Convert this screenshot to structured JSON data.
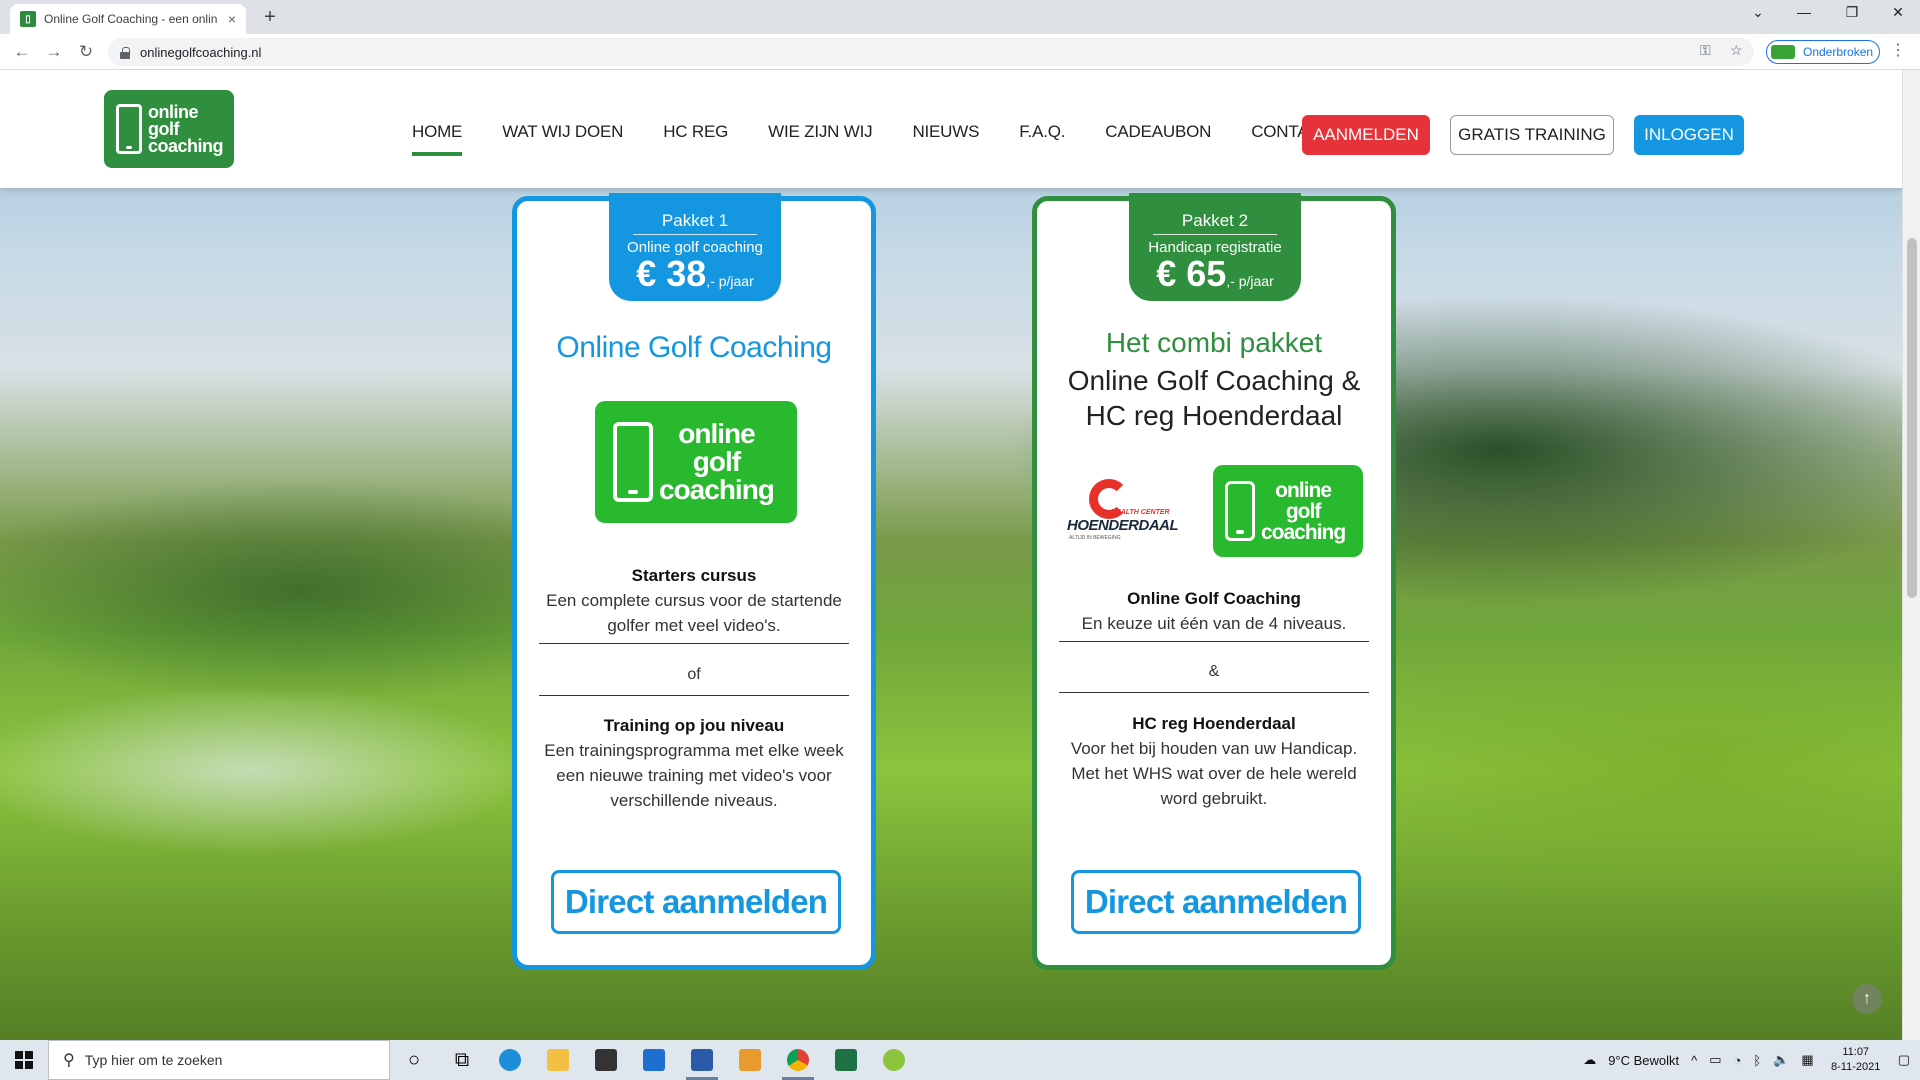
{
  "browser": {
    "tab_title": "Online Golf Coaching - een onlin",
    "tab_close": "×",
    "new_tab": "+",
    "url": "onlinegolfcoaching.nl",
    "profile_label": "Onderbroken",
    "win_minimize": "—",
    "win_restore": "❐",
    "win_close": "✕",
    "tab_dropdown": "⌄"
  },
  "site": {
    "logo_text": [
      "online",
      "golf",
      "coaching"
    ],
    "menu": [
      "HOME",
      "WAT WIJ DOEN",
      "HC REG",
      "WIE ZIJN WIJ",
      "NIEUWS",
      "F.A.Q.",
      "CADEAUBON",
      "CONTACT"
    ],
    "btn_register": "AANMELDEN",
    "btn_free": "GRATIS TRAINING",
    "btn_login": "INLOGGEN"
  },
  "card1": {
    "package": "Pakket 1",
    "subtitle": "Online golf coaching",
    "price": "€ 38",
    "unit": ",- p/jaar",
    "title": "Online Golf Coaching",
    "logo_text": [
      "online",
      "golf",
      "coaching"
    ],
    "block1_title": "Starters cursus",
    "block1_text": "Een complete cursus voor de startende golfer met veel video's.",
    "separator": "of",
    "block2_title": "Training op jou niveau",
    "block2_text": "Een trainingsprogramma met elke week een nieuwe training met video's voor verschillende niveaus.",
    "cta": "Direct aanmelden"
  },
  "card2": {
    "package": "Pakket 2",
    "subtitle": "Handicap registratie",
    "price": "€ 65",
    "unit": ",- p/jaar",
    "title_line1": "Het combi pakket",
    "title_line2": "Online Golf Coaching &",
    "title_line3": "HC reg Hoenderdaal",
    "partner_hc": "HEALTH CENTER",
    "partner_name": "HOENDERDAAL",
    "partner_tag": "ALTIJD IN BEWEGING",
    "logo_text": [
      "online",
      "golf",
      "coaching"
    ],
    "block1_title": "Online Golf Coaching",
    "block1_text": "En keuze uit één van de 4 niveaus.",
    "separator": "&",
    "block2_title": "HC reg Hoenderdaal",
    "block2_text": "Voor het bij houden van uw Handicap. Met het WHS wat over de hele wereld word gebruikt.",
    "cta": "Direct aanmelden"
  },
  "taskbar": {
    "search_placeholder": "Typ hier om te zoeken",
    "weather": "9°C  Bewolkt",
    "time": "11:07",
    "date": "8-11-2021"
  },
  "colors": {
    "brand_green": "#2f8f3f",
    "brand_blue": "#1596e0",
    "accent_red": "#e63239"
  }
}
